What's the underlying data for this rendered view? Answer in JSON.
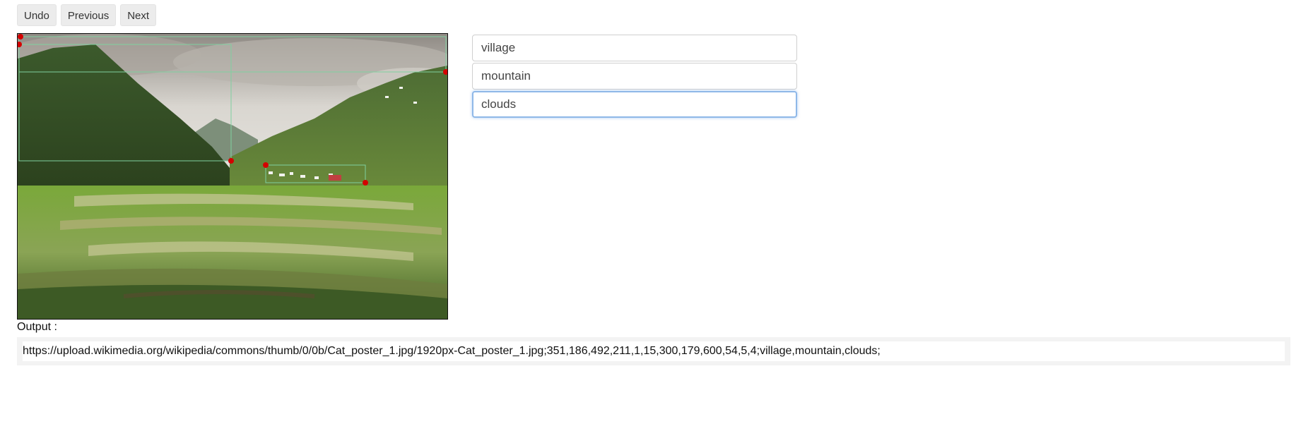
{
  "toolbar": {
    "undo_label": "Undo",
    "previous_label": "Previous",
    "next_label": "Next"
  },
  "labels": {
    "items": [
      {
        "value": "village"
      },
      {
        "value": "mountain"
      },
      {
        "value": "clouds"
      }
    ],
    "focused_index": 2
  },
  "output": {
    "label": "Output :",
    "value": "https://upload.wikimedia.org/wikipedia/commons/thumb/0/0b/Cat_poster_1.jpg/1920px-Cat_poster_1.jpg;351,186,492,211,1,15,300,179,600,54,5,4;village,mountain,clouds;"
  },
  "colors": {
    "accent_focus": "#8fb8e8",
    "handle_red": "#d40000",
    "box_green": "#7fd0a0"
  }
}
